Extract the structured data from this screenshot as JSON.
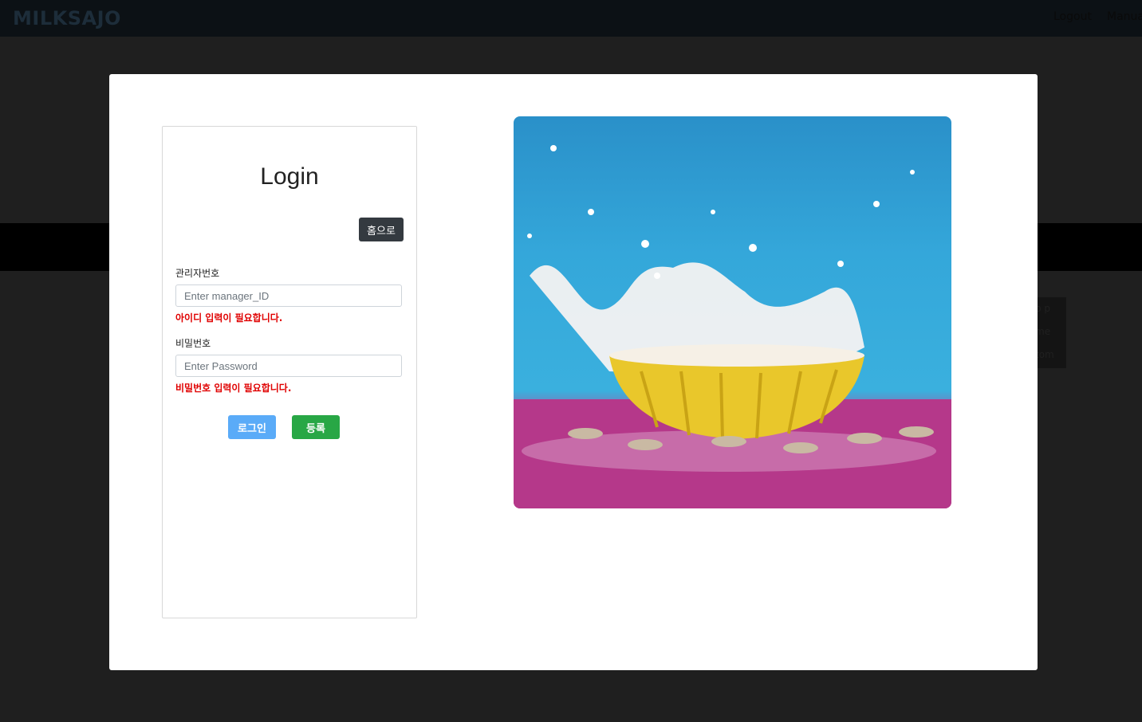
{
  "navbar": {
    "brand": "MILKSAJO",
    "logout": "Logout",
    "manual": "Manual"
  },
  "background_menu": [
    "p p",
    "me",
    "tom"
  ],
  "login": {
    "title": "Login",
    "home_button": "홈으로",
    "id_label": "관리자번호",
    "id_placeholder": "Enter manager_ID",
    "id_error": "아이디 입력이 필요합니다.",
    "password_label": "비밀번호",
    "password_placeholder": "Enter Password",
    "password_error": "비밀번호 입력이 필요합니다.",
    "login_button": "로그인",
    "register_button": "등록"
  },
  "colors": {
    "login_button": "#5aabf8",
    "register_button": "#28a745",
    "home_button": "#343a40",
    "error_text": "#e00000"
  }
}
